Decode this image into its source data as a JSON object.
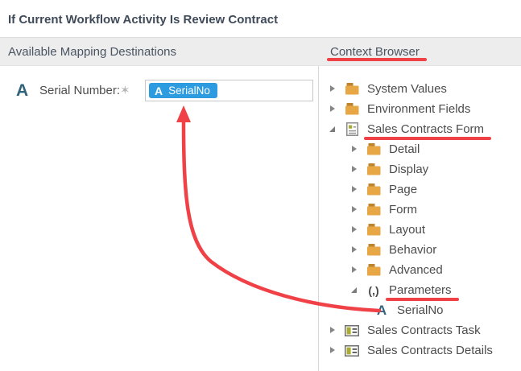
{
  "title": "If Current Workflow Activity Is Review Contract",
  "left_panel": {
    "header": "Available Mapping Destinations",
    "field": {
      "type_icon_letter": "A",
      "label": "Serial Number:",
      "required_marker": "✶",
      "input_value_chip": {
        "icon_letter": "A",
        "text": "SerialNo"
      }
    }
  },
  "right_panel": {
    "header": "Context Browser",
    "tree": [
      {
        "label": "System Values",
        "level": 1,
        "icon": "folder",
        "state": "collapsed",
        "underline": false
      },
      {
        "label": "Environment Fields",
        "level": 1,
        "icon": "folder",
        "state": "collapsed",
        "underline": false
      },
      {
        "label": "Sales Contracts Form",
        "level": 1,
        "icon": "form",
        "state": "expanded",
        "underline": true
      },
      {
        "label": "Detail",
        "level": 2,
        "icon": "folder",
        "state": "collapsed",
        "underline": false
      },
      {
        "label": "Display",
        "level": 2,
        "icon": "folder",
        "state": "collapsed",
        "underline": false
      },
      {
        "label": "Page",
        "level": 2,
        "icon": "folder",
        "state": "collapsed",
        "underline": false
      },
      {
        "label": "Form",
        "level": 2,
        "icon": "folder",
        "state": "collapsed",
        "underline": false
      },
      {
        "label": "Layout",
        "level": 2,
        "icon": "folder",
        "state": "collapsed",
        "underline": false
      },
      {
        "label": "Behavior",
        "level": 2,
        "icon": "folder",
        "state": "collapsed",
        "underline": false
      },
      {
        "label": "Advanced",
        "level": 2,
        "icon": "folder",
        "state": "collapsed",
        "underline": false
      },
      {
        "label": "Parameters",
        "level": 2,
        "icon": "parameters",
        "state": "expanded",
        "underline": true
      },
      {
        "label": "SerialNo",
        "level": 3,
        "icon": "field-a",
        "state": "leaf",
        "underline": false
      },
      {
        "label": "Sales Contracts Task",
        "level": 1,
        "icon": "view",
        "state": "collapsed",
        "underline": false
      },
      {
        "label": "Sales Contracts Details",
        "level": 1,
        "icon": "view",
        "state": "collapsed",
        "underline": false
      }
    ]
  },
  "annotations": {
    "underlined_items": [
      "Context Browser",
      "Sales Contracts Form",
      "Parameters"
    ],
    "arrow": {
      "from": "tree-item-serialno",
      "to": "serialno-mapping-chip"
    }
  },
  "colors": {
    "annotation_red": "#ef4146",
    "chip_blue": "#2d9be0",
    "field_type_navy": "#31627c",
    "folder_body": "#e7a744",
    "folder_tab": "#bd832d",
    "view_olive": "#a9ab33",
    "band_gray": "#ededed"
  }
}
